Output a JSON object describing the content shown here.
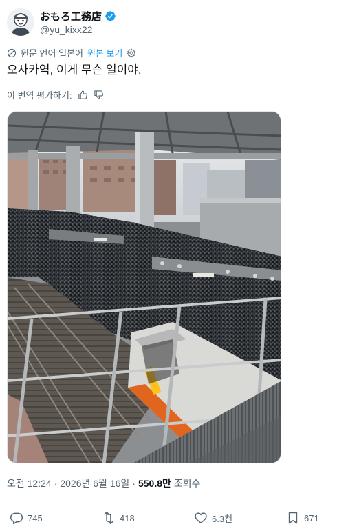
{
  "author": {
    "display_name": "おもろ工務店",
    "handle": "@yu_kixx22",
    "verified": true,
    "avatar_icon": "avatar-icon"
  },
  "translation": {
    "source_text": "원문 언어 일본어",
    "show_original": "원본 보기"
  },
  "tweet": {
    "text": "오사카역, 이게 무슨 일이야."
  },
  "rate_translation": {
    "label": "이 번역 평가하기:"
  },
  "meta": {
    "time": "오전 12:24",
    "sep1": "·",
    "date": "2026년 6월 16일",
    "sep2": "·",
    "views": "550.8만",
    "views_label": "조회수"
  },
  "actions": {
    "replies": "745",
    "reposts": "418",
    "likes": "6.3천",
    "bookmarks": "671"
  },
  "colors": {
    "accent": "#1d9bf0",
    "text_primary": "#0f1419",
    "text_secondary": "#536471",
    "train_orange": "#e0651f"
  }
}
